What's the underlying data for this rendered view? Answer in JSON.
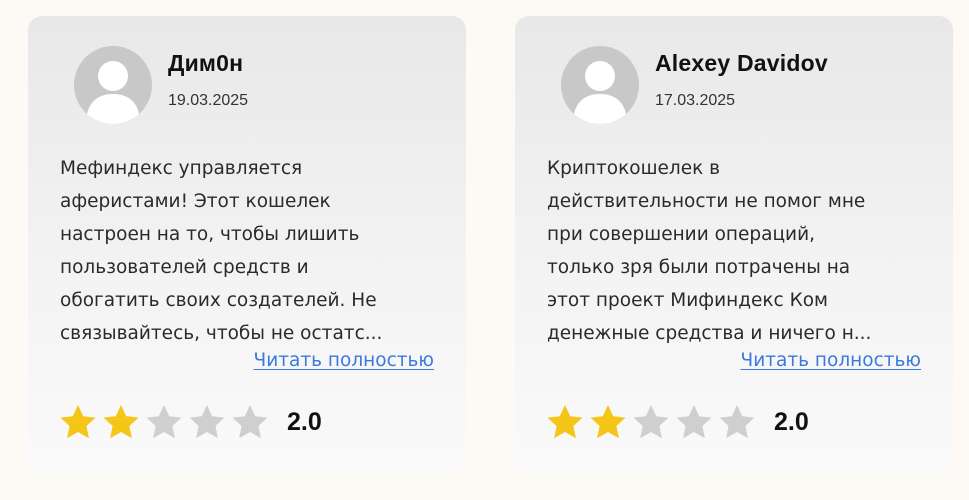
{
  "colors": {
    "page_bg": "#fdf9f4",
    "card_bg": "#ececec",
    "star_filled": "#f5c518",
    "star_empty": "#cfcfcf",
    "link": "#3b78e0"
  },
  "reviews": [
    {
      "author": "Дим0н",
      "date": "19.03.2025",
      "text_lines": [
        "Мефиндекс управляется",
        "аферистами! Этот кошелек",
        "настроен на то, чтобы лишить",
        "пользователей средств и",
        "обогатить своих создателей. Не",
        "связывайтесь, чтобы не остатс..."
      ],
      "read_more": "Читать полностью",
      "rating": 2,
      "rating_max": 5,
      "score_label": "2.0",
      "avatar_icon": "user-placeholder-icon"
    },
    {
      "author": "Alexey Davidov",
      "date": "17.03.2025",
      "text_lines": [
        "Криптокошелек в",
        "действительности не помог мне",
        "при совершении операций,",
        "только зря были потрачены на",
        "этот проект Мифиндекс Ком",
        "денежные средства и ничего н..."
      ],
      "read_more": "Читать полностью",
      "rating": 2,
      "rating_max": 5,
      "score_label": "2.0",
      "avatar_icon": "user-placeholder-icon"
    }
  ]
}
